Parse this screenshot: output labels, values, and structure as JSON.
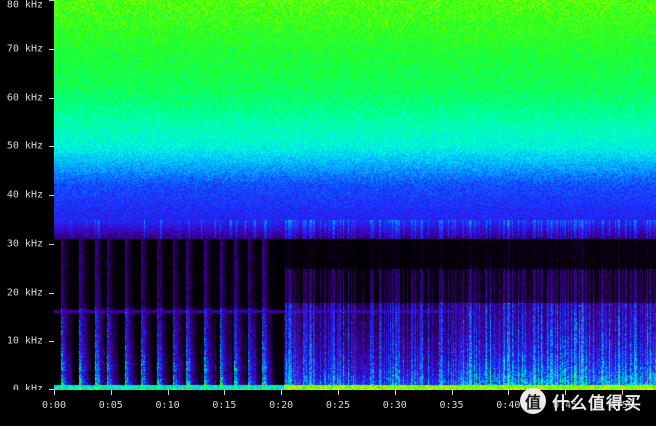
{
  "spectrogram": {
    "freq_axis": {
      "unit": "kHz",
      "ticks": [
        {
          "value": 0,
          "label": "0 kHz"
        },
        {
          "value": 10,
          "label": "10 kHz"
        },
        {
          "value": 20,
          "label": "20 kHz"
        },
        {
          "value": 30,
          "label": "30 kHz"
        },
        {
          "value": 40,
          "label": "40 kHz"
        },
        {
          "value": 50,
          "label": "50 kHz"
        },
        {
          "value": 60,
          "label": "60 kHz"
        },
        {
          "value": 70,
          "label": "70 kHz"
        },
        {
          "value": 80,
          "label": "80 kHz"
        }
      ],
      "range": [
        0,
        80
      ]
    },
    "time_axis": {
      "ticks": [
        {
          "value": 0,
          "label": "0:00"
        },
        {
          "value": 5,
          "label": "0:05"
        },
        {
          "value": 10,
          "label": "0:10"
        },
        {
          "value": 15,
          "label": "0:15"
        },
        {
          "value": 20,
          "label": "0:20"
        },
        {
          "value": 25,
          "label": "0:25"
        },
        {
          "value": 30,
          "label": "0:30"
        },
        {
          "value": 35,
          "label": "0:35"
        },
        {
          "value": 40,
          "label": "0:40"
        },
        {
          "value": 45,
          "label": "0:45"
        },
        {
          "value": 50,
          "label": "0:50"
        }
      ],
      "range_seconds": [
        0,
        53
      ]
    },
    "colormap": [
      "#000000",
      "#2a0060",
      "#3a10c8",
      "#1030ff",
      "#00c8ff",
      "#00ff80",
      "#40ff00",
      "#ffff00",
      "#ff4000"
    ]
  },
  "watermark": {
    "logo_glyph": "值",
    "text": "什么值得买"
  }
}
